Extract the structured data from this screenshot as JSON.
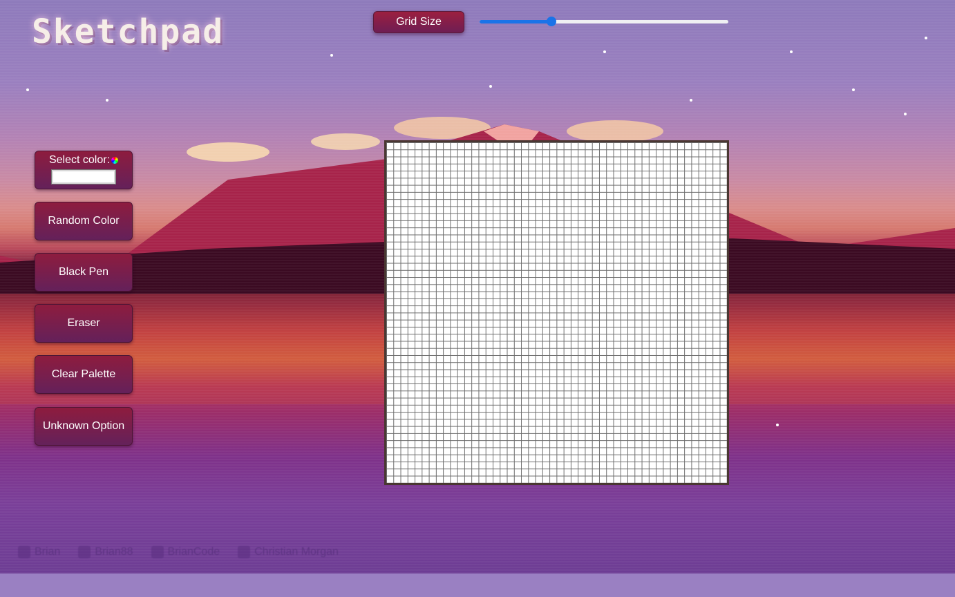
{
  "app": {
    "title": "Sketchpad"
  },
  "header": {
    "grid_size_label": "Grid Size",
    "slider": {
      "value": 0.29
    }
  },
  "tools": {
    "select_color_label": "Select color:",
    "selected_color": "#ffffff",
    "random_color_label": "Random Color",
    "black_pen_label": "Black Pen",
    "eraser_label": "Eraser",
    "clear_palette_label": "Clear Palette",
    "unknown_option_label": "Unknown Option"
  },
  "canvas": {
    "grid_cells_per_side": 48
  },
  "footer": {
    "links": [
      {
        "icon": "instagram-icon",
        "label": "Brian"
      },
      {
        "icon": "twitter-icon",
        "label": "Brian88"
      },
      {
        "icon": "github-icon",
        "label": "BrianCode"
      },
      {
        "icon": "facebook-icon",
        "label": "Christian Morgan"
      }
    ]
  },
  "colors": {
    "button_top": "#8e1c3e",
    "button_bottom": "#64215a",
    "accent": "#1a73e8",
    "grid_line": "#6b6b6b",
    "canvas_border": "#4a3732"
  }
}
